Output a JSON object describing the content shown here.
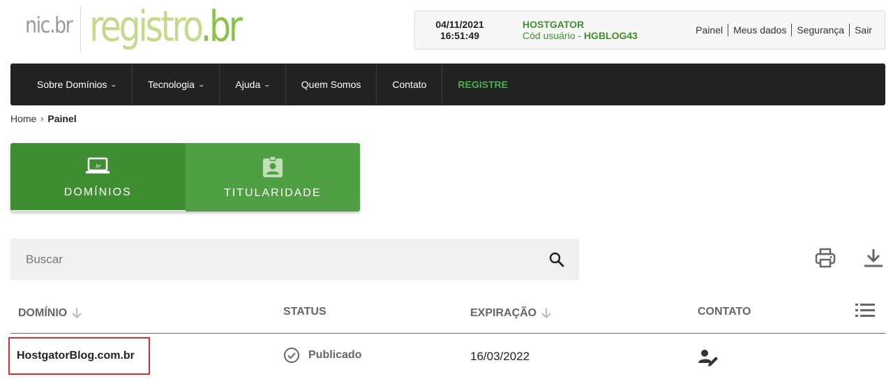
{
  "header": {
    "logo_nic": "nic.br",
    "logo_registro": "registro",
    "logo_br": ".br",
    "date": "04/11/2021",
    "time": "16:51:49",
    "user_name": "HOSTGATOR",
    "user_code_label": "Cód usuário - ",
    "user_code": "HGBLOG43",
    "links": [
      "Painel",
      "Meus dados",
      "Segurança",
      "Sair"
    ]
  },
  "nav": {
    "items": [
      {
        "label": "Sobre Domínios",
        "dropdown": true
      },
      {
        "label": "Tecnologia",
        "dropdown": true
      },
      {
        "label": "Ajuda",
        "dropdown": true
      },
      {
        "label": "Quem Somos",
        "dropdown": false
      },
      {
        "label": "Contato",
        "dropdown": false
      },
      {
        "label": "REGISTRE",
        "dropdown": false
      }
    ]
  },
  "breadcrumb": {
    "home": "Home",
    "separator": "›",
    "current": "Painel"
  },
  "tabs": [
    {
      "label": "DOMÍNIOS",
      "icon": "laptop-br-icon",
      "active": true
    },
    {
      "label": "TITULARIDADE",
      "icon": "id-badge-icon",
      "active": false
    }
  ],
  "search": {
    "placeholder": "Buscar",
    "value": ""
  },
  "table": {
    "headers": {
      "domain": "DOMÍNIO",
      "status": "STATUS",
      "expiration": "EXPIRAÇÃO",
      "contact": "CONTATO"
    },
    "rows": [
      {
        "domain": "HostgatorBlog.com.br",
        "status": "Publicado",
        "expiration": "16/03/2022"
      }
    ]
  },
  "colors": {
    "accent_green": "#3f8f32",
    "tab_inactive": "#4ea043",
    "nav_bg": "#222222",
    "highlight_red": "#d32f2f"
  }
}
